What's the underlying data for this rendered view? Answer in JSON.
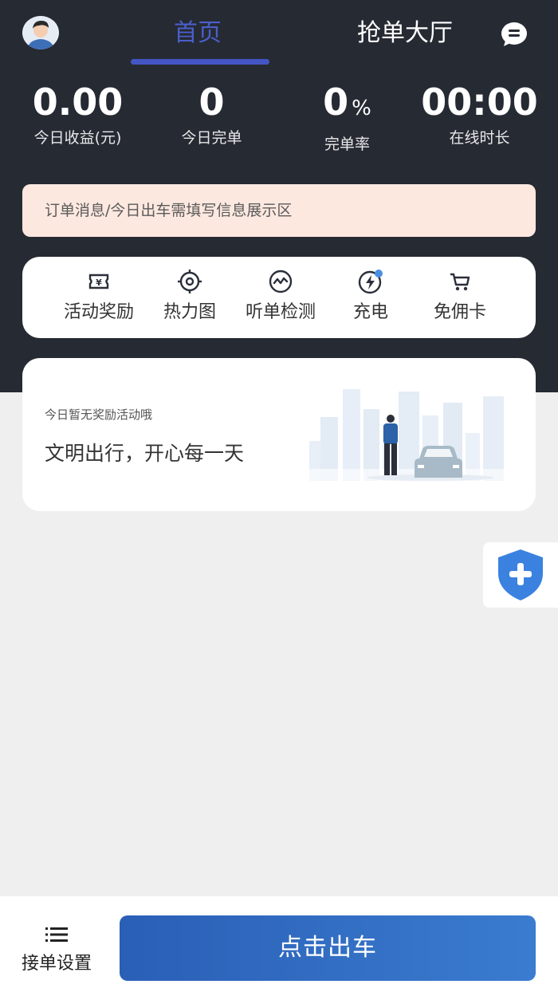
{
  "header": {
    "tabs": [
      {
        "label": "首页",
        "active": true
      },
      {
        "label": "抢单大厅",
        "active": false
      }
    ],
    "avatar_icon": "driver-avatar-icon",
    "message_icon": "message-icon"
  },
  "stats": [
    {
      "value": "0.00",
      "unit": "",
      "label": "今日收益(元)"
    },
    {
      "value": "0",
      "unit": "",
      "label": "今日完单"
    },
    {
      "value": "0",
      "unit": "%",
      "label": "完单率"
    },
    {
      "value": "00:00",
      "unit": "",
      "label": "在线时长"
    }
  ],
  "notice": {
    "text": "订单消息/今日出车需填写信息展示区"
  },
  "quick_menu": [
    {
      "label": "活动奖励",
      "icon": "ticket-icon"
    },
    {
      "label": "热力图",
      "icon": "target-icon"
    },
    {
      "label": "听单检测",
      "icon": "pulse-icon"
    },
    {
      "label": "充电",
      "icon": "charge-icon"
    },
    {
      "label": "免佣卡",
      "icon": "cart-icon"
    }
  ],
  "reward_card": {
    "subtitle": "今日暂无奖励活动哦",
    "title": "文明出行，开心每一天"
  },
  "safety": {
    "icon": "shield-plus-icon"
  },
  "bottom": {
    "settings_label": "接单设置",
    "go_button": "点击出车"
  },
  "colors": {
    "dark_bg": "#262a33",
    "accent": "#4456c4",
    "notice_bg": "#fde8e0",
    "button_blue": "#2f6bc0",
    "shield_blue": "#3b82e0"
  }
}
